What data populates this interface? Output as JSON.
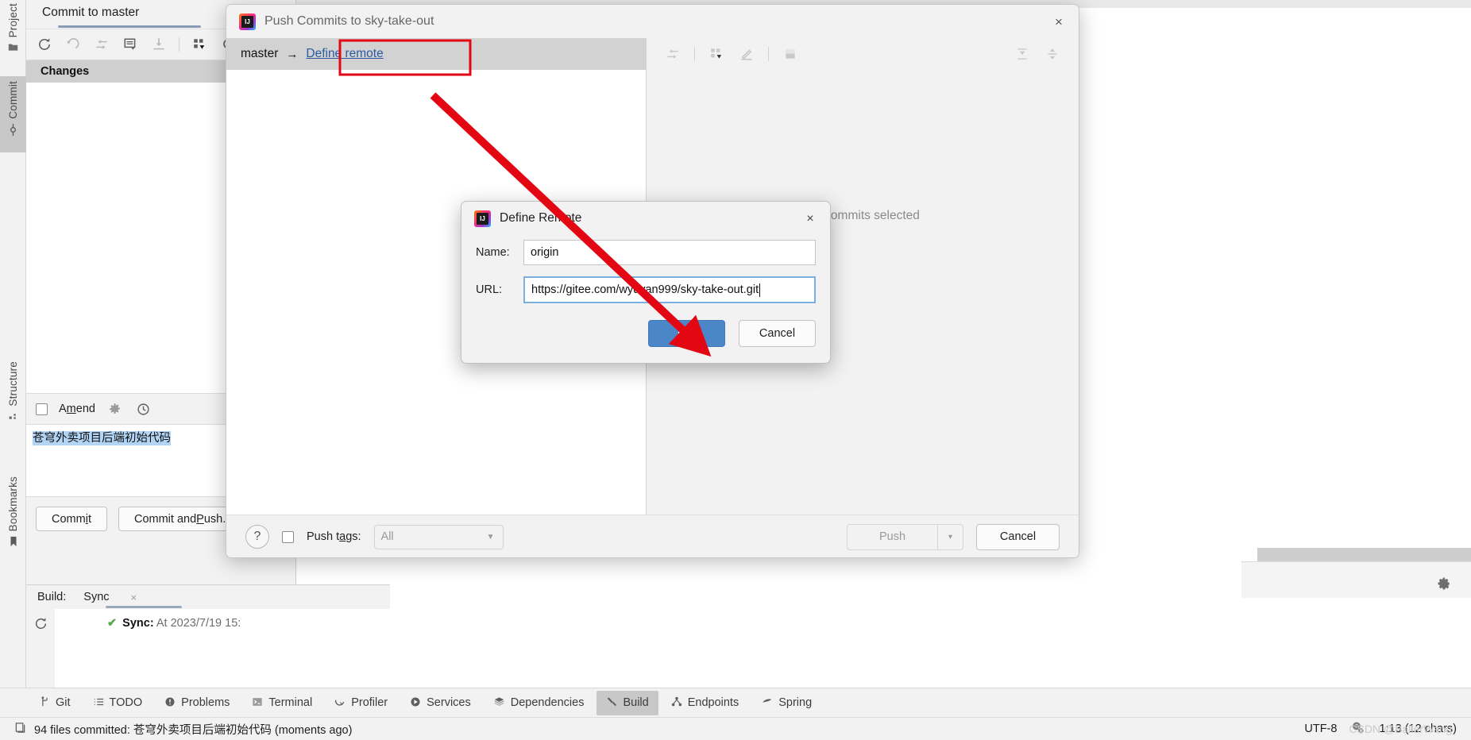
{
  "colors": {
    "accent_blue": "#4a86c8",
    "link_blue": "#2c5aa0",
    "annotation_red": "#e30613",
    "selection_blue": "#b3d5f5",
    "success_green": "#5aa84f"
  },
  "toolstrip": {
    "items": [
      {
        "label": "Project",
        "icon": "folder-icon",
        "active": false
      },
      {
        "label": "Commit",
        "icon": "commit-icon",
        "active": true
      },
      {
        "label": "Structure",
        "icon": "structure-icon",
        "active": false
      },
      {
        "label": "Bookmarks",
        "icon": "bookmark-icon",
        "active": false
      }
    ]
  },
  "commit_panel": {
    "tab_label": "Commit to master",
    "toolbar_icons": [
      "refresh-icon",
      "rollback-icon",
      "show-diff-icon",
      "commit-message-icon",
      "update-icon",
      "group-by-icon",
      "preview-icon"
    ],
    "changes_header": "Changes",
    "amend_label": "Amend",
    "amend_checked": false,
    "amend_icons": [
      "gear-icon",
      "history-icon"
    ],
    "commit_message": "苍穹外卖项目后端初始代码",
    "commit_button": "Commit",
    "commit_and_push_button": "Commit and Push..."
  },
  "build_panel": {
    "label": "Build:",
    "tab": "Sync",
    "close": "×",
    "rail_icon": "refresh-icon",
    "console_status": "Sync:",
    "console_text": "At 2023/7/19 15:"
  },
  "push_dialog": {
    "title": "Push Commits to sky-take-out",
    "icon": "intellij-idea-icon",
    "close": "×",
    "branch": "master",
    "branch_arrow": "→",
    "define_remote_link": "Define remote",
    "empty_message": "No commits selected",
    "toolbar_icons": [
      "show-diff-icon",
      "group-by-icon",
      "annotate-icon",
      "editor-preview-icon",
      "expand-all-icon",
      "collapse-all-icon"
    ],
    "help_button": "?",
    "push_tags_label": "Push tags:",
    "push_tags_checked": false,
    "push_tags_value": "All",
    "push_button": "Push",
    "push_dropdown_caret": "▾",
    "cancel_button": "Cancel"
  },
  "define_remote_dialog": {
    "title": "Define Remote",
    "icon": "intellij-idea-icon",
    "close": "×",
    "name_label": "Name:",
    "name_value": "origin",
    "url_label": "URL:",
    "url_value": "https://gitee.com/wyuyan999/sky-take-out.git",
    "ok_button": "OK",
    "cancel_button": "Cancel"
  },
  "bottom_tabs": [
    {
      "label": "Git",
      "icon": "git-branch-icon",
      "active": false
    },
    {
      "label": "TODO",
      "icon": "todo-list-icon",
      "active": false
    },
    {
      "label": "Problems",
      "icon": "problems-icon",
      "active": false
    },
    {
      "label": "Terminal",
      "icon": "terminal-icon",
      "active": false
    },
    {
      "label": "Profiler",
      "icon": "profiler-icon",
      "active": false
    },
    {
      "label": "Services",
      "icon": "services-icon",
      "active": false
    },
    {
      "label": "Dependencies",
      "icon": "dependencies-icon",
      "active": false
    },
    {
      "label": "Build",
      "icon": "build-hammer-icon",
      "active": true
    },
    {
      "label": "Endpoints",
      "icon": "endpoints-icon",
      "active": false
    },
    {
      "label": "Spring",
      "icon": "spring-leaf-icon",
      "active": false
    }
  ],
  "status_bar": {
    "message_icon": "notification-icon",
    "message": "94 files committed: 苍穹外卖项目后端初始代码 (moments ago)",
    "encoding": "UTF-8",
    "help_icon": "help-gear-icon",
    "caret_position": "1:13 (12 chars)",
    "watermark": "CSDN @BallerWang"
  }
}
